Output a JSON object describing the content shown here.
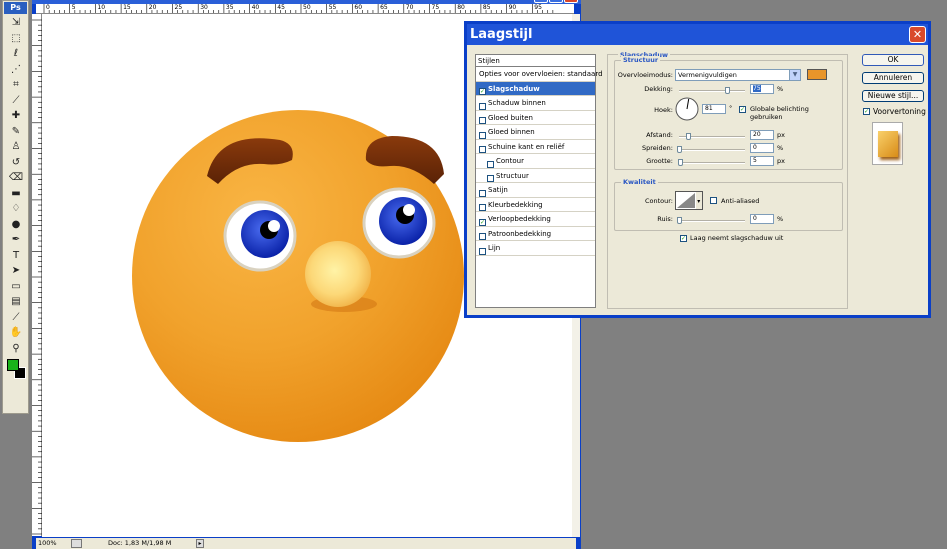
{
  "app": {
    "logo": "Ps"
  },
  "toolbox": {
    "tools": [
      {
        "name": "move-tool-icon",
        "glyph": "⇲"
      },
      {
        "name": "marquee-tool-icon",
        "glyph": "⬚"
      },
      {
        "name": "lasso-tool-icon",
        "glyph": "ℓ"
      },
      {
        "name": "magic-wand-tool-icon",
        "glyph": "⋰"
      },
      {
        "name": "crop-tool-icon",
        "glyph": "⌗"
      },
      {
        "name": "slice-tool-icon",
        "glyph": "⟋"
      },
      {
        "name": "healing-brush-tool-icon",
        "glyph": "✚"
      },
      {
        "name": "brush-tool-icon",
        "glyph": "✎"
      },
      {
        "name": "clone-stamp-tool-icon",
        "glyph": "♙"
      },
      {
        "name": "history-brush-tool-icon",
        "glyph": "↺"
      },
      {
        "name": "eraser-tool-icon",
        "glyph": "⌫"
      },
      {
        "name": "gradient-tool-icon",
        "glyph": "▬"
      },
      {
        "name": "blur-tool-icon",
        "glyph": "♢"
      },
      {
        "name": "dodge-tool-icon",
        "glyph": "●"
      },
      {
        "name": "pen-tool-icon",
        "glyph": "✒"
      },
      {
        "name": "type-tool-icon",
        "glyph": "T"
      },
      {
        "name": "path-selection-tool-icon",
        "glyph": "➤"
      },
      {
        "name": "shape-tool-icon",
        "glyph": "▭"
      },
      {
        "name": "notes-tool-icon",
        "glyph": "▤"
      },
      {
        "name": "eyedropper-tool-icon",
        "glyph": "⟋"
      },
      {
        "name": "hand-tool-icon",
        "glyph": "✋"
      },
      {
        "name": "zoom-tool-icon",
        "glyph": "⚲"
      }
    ],
    "foreground_color": "#19b219",
    "background_color": "#000000"
  },
  "document": {
    "ruler_ticks": [
      "0",
      "5",
      "10",
      "15",
      "20",
      "25",
      "30",
      "35",
      "40",
      "45",
      "50",
      "55",
      "60",
      "65",
      "70",
      "75",
      "80",
      "85",
      "90",
      "95"
    ],
    "zoom": "100%",
    "doc_info": "Doc: 1,83 M/1,98 M"
  },
  "dialog": {
    "title": "Laagstijl",
    "styles_header": "Stijlen",
    "blend_options": "Opties voor overvloeien: standaard",
    "styles": [
      {
        "label": "Slagschaduw",
        "checked": true,
        "selected": true,
        "indent": false
      },
      {
        "label": "Schaduw binnen",
        "checked": false,
        "selected": false,
        "indent": false
      },
      {
        "label": "Gloed buiten",
        "checked": false,
        "selected": false,
        "indent": false
      },
      {
        "label": "Gloed binnen",
        "checked": false,
        "selected": false,
        "indent": false
      },
      {
        "label": "Schuine kant en reliëf",
        "checked": false,
        "selected": false,
        "indent": false
      },
      {
        "label": "Contour",
        "checked": false,
        "selected": false,
        "indent": true
      },
      {
        "label": "Structuur",
        "checked": false,
        "selected": false,
        "indent": true
      },
      {
        "label": "Satijn",
        "checked": false,
        "selected": false,
        "indent": false
      },
      {
        "label": "Kleurbedekking",
        "checked": false,
        "selected": false,
        "indent": false
      },
      {
        "label": "Verloopbedekking",
        "checked": true,
        "selected": false,
        "indent": false
      },
      {
        "label": "Patroonbedekking",
        "checked": false,
        "selected": false,
        "indent": false
      },
      {
        "label": "Lijn",
        "checked": false,
        "selected": false,
        "indent": false
      }
    ],
    "section_title": "Slagschaduw",
    "structure": {
      "legend": "Structuur",
      "blend_mode_label": "Overvloeimodus:",
      "blend_mode_value": "Vermenigvuldigen",
      "shadow_color": "#e8952a",
      "opacity_label": "Dekking:",
      "opacity_value": "75",
      "opacity_unit": "%",
      "angle_label": "Hoek:",
      "angle_value": "81",
      "angle_unit": "°",
      "global_light_label": "Globale belichting gebruiken",
      "distance_label": "Afstand:",
      "distance_value": "20",
      "distance_unit": "px",
      "spread_label": "Spreiden:",
      "spread_value": "0",
      "spread_unit": "%",
      "size_label": "Grootte:",
      "size_value": "5",
      "size_unit": "px"
    },
    "quality": {
      "legend": "Kwaliteit",
      "contour_label": "Contour:",
      "anti_aliased_label": "Anti-aliased",
      "noise_label": "Ruis:",
      "noise_value": "0",
      "noise_unit": "%"
    },
    "knockout_label": "Laag neemt slagschaduw uit",
    "buttons": {
      "ok": "OK",
      "cancel": "Annuleren",
      "new_style": "Nieuwe stijl...",
      "preview": "Voorvertoning"
    }
  }
}
